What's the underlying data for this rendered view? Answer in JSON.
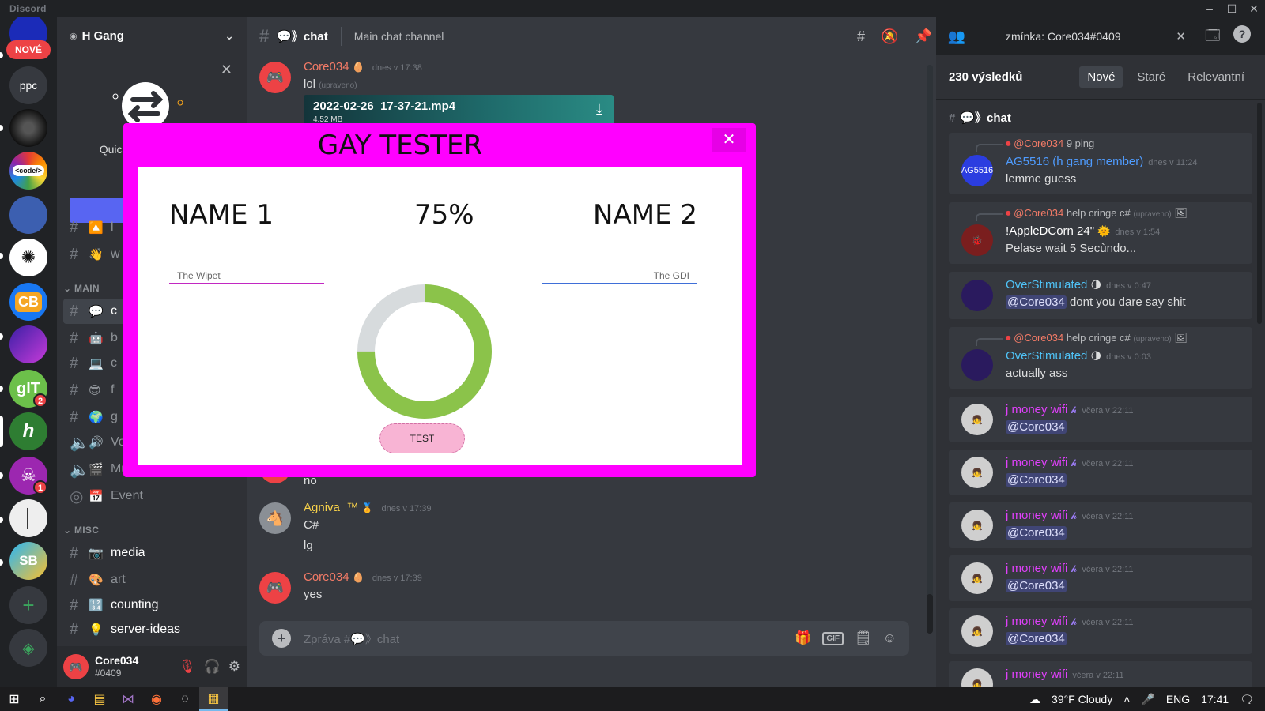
{
  "window": {
    "app_name": "Discord"
  },
  "rail": {
    "new_badge": "NOVÉ",
    "ppc_label": "ppc",
    "code_label": "<code/>",
    "cb_label": "CB",
    "glt_label": "glT",
    "glt_badge": "2",
    "h_label": "h",
    "skull_badge": "1",
    "sb_label": "SB"
  },
  "sidebar": {
    "guild_name": "H Gang",
    "quick_switcher_text": "Quick Switc přesouvá",
    "categories": {
      "main": "MAIN",
      "misc": "MISC"
    },
    "channels": [
      {
        "emoji": "🔼",
        "name": "l"
      },
      {
        "emoji": "👋",
        "name": "w"
      },
      {
        "emoji": "💬",
        "name": "c"
      },
      {
        "emoji": "🤖",
        "name": "b"
      },
      {
        "emoji": "💻",
        "name": "c"
      },
      {
        "emoji": "😎",
        "name": "f"
      },
      {
        "emoji": "🌍",
        "name": "g"
      },
      {
        "emoji": "🔊",
        "name": "Vo"
      },
      {
        "emoji": "🎬",
        "name": "Music"
      },
      {
        "emoji": "📅",
        "name": "Event"
      },
      {
        "emoji": "📷",
        "name": "media"
      },
      {
        "emoji": "🎨",
        "name": "art"
      },
      {
        "emoji": "🔢",
        "name": "counting"
      },
      {
        "emoji": "💡",
        "name": "server-ideas"
      }
    ],
    "user": {
      "name": "Core034",
      "discriminator": "#0409"
    }
  },
  "header": {
    "channel": "💬》chat",
    "topic": "Main chat channel",
    "search_value": "zmínka: Core034#0409"
  },
  "messages": [
    {
      "author": "Core034",
      "color": "#f47b67",
      "time": "dnes v 17:38",
      "text": "lol",
      "edited": "(upraveno)",
      "attachment": {
        "filename": "2022-02-26_17-37-21.mp4",
        "size": "4.52 MB"
      }
    },
    {
      "author": "",
      "text": "no"
    },
    {
      "author": "Agniva_™",
      "color": "#f8d24a",
      "time": "dnes v 17:39",
      "lines": [
        "C#",
        "lg"
      ]
    },
    {
      "author": "Core034",
      "color": "#f47b67",
      "time": "dnes v 17:39",
      "text": "yes"
    }
  ],
  "composer": {
    "placeholder": "Zpráva #💬》chat",
    "gif": "GIF"
  },
  "results": {
    "count": "230 výsledků",
    "tabs": [
      "Nové",
      "Staré",
      "Relevantní"
    ],
    "channel": "💬》chat",
    "items": [
      {
        "reply_to": "@Core034",
        "reply_text": "9 ping",
        "author": "AG5516 (h gang member)",
        "color": "#4f9cff",
        "time": "dnes v 11:24",
        "text": "lemme guess",
        "avatar_label": "AG5516"
      },
      {
        "reply_to": "@Core034",
        "reply_text": "help cringe c#",
        "reply_edited": "(upraveno)",
        "author": "!AppleDCorn 24\"",
        "color": "#ffffff",
        "time": "dnes v 1:54",
        "text": "Pelase wait 5 Secùndo..."
      },
      {
        "author": "OverStimulated",
        "color": "#4fc3f7",
        "time": "dnes v 0:47",
        "mention": "@Core034",
        "text": " dont you dare say shit"
      },
      {
        "reply_to": "@Core034",
        "reply_text": "help cringe c#",
        "reply_edited": "(upraveno)",
        "author": "OverStimulated",
        "color": "#4fc3f7",
        "time": "dnes v 0:03",
        "text": "actually ass"
      },
      {
        "author": "j money wifi",
        "color": "#e040fb",
        "time": "včera v 22:11",
        "mention": "@Core034"
      },
      {
        "author": "j money wifi",
        "color": "#e040fb",
        "time": "včera v 22:11",
        "mention": "@Core034"
      },
      {
        "author": "j money wifi",
        "color": "#e040fb",
        "time": "včera v 22:11",
        "mention": "@Core034"
      },
      {
        "author": "j money wifi",
        "color": "#e040fb",
        "time": "včera v 22:11",
        "mention": "@Core034"
      },
      {
        "author": "j money wifi",
        "color": "#e040fb",
        "time": "včera v 22:11",
        "mention": "@Core034"
      },
      {
        "author": "j money wifi",
        "color": "#e040fb",
        "time": "včera v 22:11"
      }
    ]
  },
  "modal": {
    "title": "GAY TESTER",
    "name1_label": "NAME 1",
    "name2_label": "NAME 2",
    "percent": "75%",
    "percent_value": 0.75,
    "name1_value": "The Wipet",
    "name2_value": "The GDI",
    "button": "TEST",
    "colors": {
      "frame": "#ff00ff",
      "donut_fill": "#8bc34a",
      "donut_rest": "#d7dbdd"
    }
  },
  "taskbar": {
    "weather": "39°F  Cloudy",
    "lang": "ENG",
    "time": "17:41"
  }
}
